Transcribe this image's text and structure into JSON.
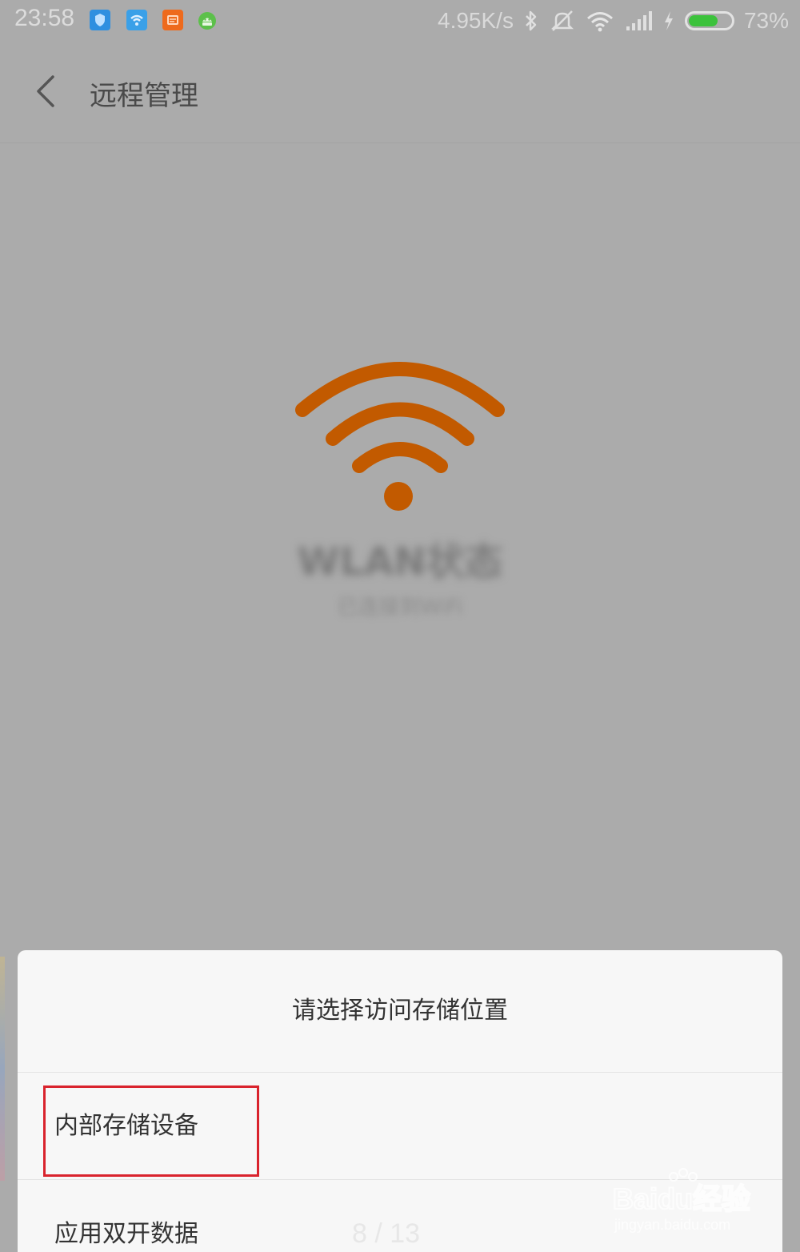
{
  "status_bar": {
    "time": "23:58",
    "network_speed": "4.95K/s",
    "battery_percent": "73%",
    "battery_level": 0.73,
    "notification_icons": [
      "vpn-shield-icon",
      "wifi-app-icon",
      "message-app-icon",
      "android-app-icon"
    ],
    "system_icons": [
      "bluetooth-icon",
      "mute-icon",
      "wifi-icon",
      "signal-icon",
      "charging-icon",
      "battery-icon"
    ]
  },
  "title_bar": {
    "title": "远程管理"
  },
  "main": {
    "icon": "wifi-icon",
    "icon_color": "#c25a00",
    "status_title": "WLAN状态",
    "status_subtitle": "已连接到WiFi"
  },
  "sheet": {
    "title": "请选择访问存储位置",
    "items": [
      {
        "label": "内部存储设备"
      },
      {
        "label": "应用双开数据"
      }
    ]
  },
  "page_indicator": "8 / 13",
  "watermark": {
    "brand": "Baidu经验",
    "url": "jingyan.baidu.com"
  },
  "colors": {
    "background": "#ababab",
    "sheet": "#f7f7f7",
    "highlight": "#d9232d"
  }
}
